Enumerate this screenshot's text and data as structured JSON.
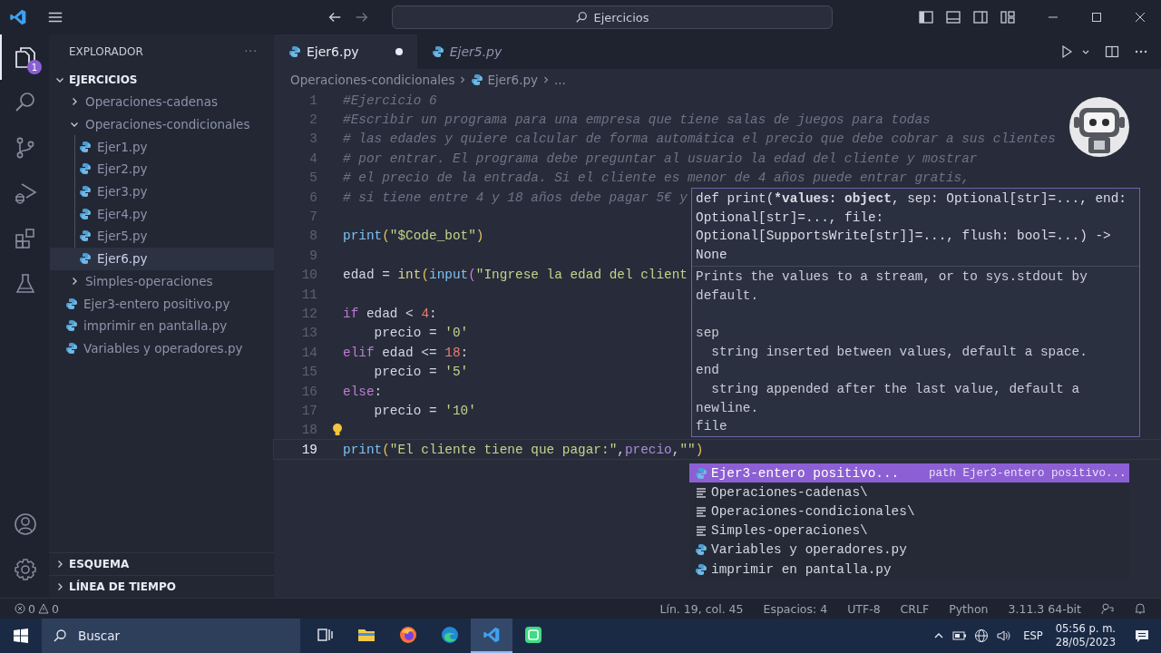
{
  "title_bar": {
    "search": "Ejercicios"
  },
  "activity_bar": {
    "top": [
      {
        "kind": "files",
        "selected": true,
        "badge": "1"
      },
      {
        "kind": "search",
        "selected": false
      },
      {
        "kind": "branch",
        "selected": false
      },
      {
        "kind": "run",
        "selected": false
      },
      {
        "kind": "extensions",
        "selected": false
      },
      {
        "kind": "flask",
        "selected": false
      }
    ],
    "bottom": [
      {
        "kind": "account",
        "selected": false
      },
      {
        "kind": "settings",
        "selected": false
      }
    ]
  },
  "sidebar": {
    "title": "EXPLORADOR",
    "more": "···",
    "root": {
      "label": "EJERCICIOS",
      "expanded": true,
      "children": [
        {
          "label": "Operaciones-cadenas",
          "kind": "folder",
          "expanded": false
        },
        {
          "label": "Operaciones-condicionales",
          "kind": "folder",
          "expanded": true,
          "children": [
            {
              "label": "Ejer1.py",
              "kind": "file",
              "selected": false
            },
            {
              "label": "Ejer2.py",
              "kind": "file",
              "selected": false
            },
            {
              "label": "Ejer3.py",
              "kind": "file",
              "selected": false
            },
            {
              "label": "Ejer4.py",
              "kind": "file",
              "selected": false
            },
            {
              "label": "Ejer5.py",
              "kind": "file",
              "selected": false
            },
            {
              "label": "Ejer6.py",
              "kind": "file",
              "selected": true
            }
          ]
        },
        {
          "label": "Simples-operaciones",
          "kind": "folder",
          "expanded": false
        },
        {
          "label": "Ejer3-entero positivo.py",
          "kind": "file",
          "selected": false
        },
        {
          "label": "imprimir en pantalla.py",
          "kind": "file",
          "selected": false
        },
        {
          "label": "Variables y operadores.py",
          "kind": "file",
          "selected": false
        }
      ]
    },
    "sections": [
      {
        "label": "ESQUEMA",
        "expanded": false
      },
      {
        "label": "LÍNEA DE TIEMPO",
        "expanded": false
      }
    ]
  },
  "tabs": [
    {
      "label": "Ejer6.py",
      "selected": true,
      "modified": true,
      "preview": false
    },
    {
      "label": "Ejer5.py",
      "selected": false,
      "modified": false,
      "preview": true
    }
  ],
  "breadcrumbs": [
    {
      "label": "Operaciones-condicionales",
      "kind": "folder"
    },
    {
      "label": "Ejer6.py",
      "kind": "file"
    },
    {
      "label": "...",
      "kind": "more"
    }
  ],
  "code": [
    {
      "n": "1",
      "tokens": [
        {
          "kind": "comment",
          "text": "#Ejercicio 6"
        }
      ]
    },
    {
      "n": "2",
      "tokens": [
        {
          "kind": "comment",
          "text": "#Escribir un programa para una empresa que tiene salas de juegos para todas"
        }
      ]
    },
    {
      "n": "3",
      "tokens": [
        {
          "kind": "comment",
          "text": "# las edades y quiere calcular de forma automática el precio que debe cobrar a sus clientes"
        }
      ]
    },
    {
      "n": "4",
      "tokens": [
        {
          "kind": "comment",
          "text": "# por entrar. El programa debe preguntar al usuario la edad del cliente y mostrar"
        }
      ]
    },
    {
      "n": "5",
      "tokens": [
        {
          "kind": "comment",
          "text": "# el precio de la entrada. Si el cliente es menor de 4 años puede entrar gratis,"
        }
      ]
    },
    {
      "n": "6",
      "tokens": [
        {
          "kind": "comment",
          "text": "# si tiene entre 4 y 18 años debe pagar 5€ y"
        }
      ]
    },
    {
      "n": "7"
    },
    {
      "n": "8",
      "tokens": [
        {
          "kind": "func",
          "text": "print"
        },
        {
          "kind": "paren",
          "text": "("
        },
        {
          "kind": "string",
          "text": "\"$Code_bot\""
        },
        {
          "kind": "paren",
          "text": ")"
        }
      ]
    },
    {
      "n": "9"
    },
    {
      "n": "10",
      "tokens": [
        {
          "kind": "plain",
          "text": "edad = "
        },
        {
          "kind": "class",
          "text": "int"
        },
        {
          "kind": "paren",
          "text": "("
        },
        {
          "kind": "func",
          "text": "input"
        },
        {
          "kind": "paren2",
          "text": "("
        },
        {
          "kind": "string",
          "text": "\"Ingrese la edad del client"
        }
      ]
    },
    {
      "n": "11"
    },
    {
      "n": "12",
      "tokens": [
        {
          "kind": "keyword",
          "text": "if"
        },
        {
          "kind": "plain",
          "text": " edad < "
        },
        {
          "kind": "number",
          "text": "4"
        },
        {
          "kind": "plain",
          "text": ":"
        }
      ]
    },
    {
      "n": "13",
      "tokens": [
        {
          "kind": "plain",
          "text": "    precio = "
        },
        {
          "kind": "string",
          "text": "'0'"
        }
      ]
    },
    {
      "n": "14",
      "tokens": [
        {
          "kind": "keyword",
          "text": "elif"
        },
        {
          "kind": "plain",
          "text": " edad <= "
        },
        {
          "kind": "number",
          "text": "18"
        },
        {
          "kind": "plain",
          "text": ":"
        }
      ]
    },
    {
      "n": "15",
      "tokens": [
        {
          "kind": "plain",
          "text": "    precio = "
        },
        {
          "kind": "string",
          "text": "'5'"
        }
      ]
    },
    {
      "n": "16",
      "tokens": [
        {
          "kind": "keyword",
          "text": "else"
        },
        {
          "kind": "plain",
          "text": ":"
        }
      ]
    },
    {
      "n": "17",
      "tokens": [
        {
          "kind": "plain",
          "text": "    precio = "
        },
        {
          "kind": "string",
          "text": "'10'"
        }
      ]
    },
    {
      "n": "18",
      "lightbulb": true
    },
    {
      "n": "19",
      "current": true,
      "tokens": [
        {
          "kind": "func",
          "text": "print"
        },
        {
          "kind": "paren",
          "text": "("
        },
        {
          "kind": "string",
          "text": "\"El cliente tiene que pagar:\""
        },
        {
          "kind": "plain",
          "text": ","
        },
        {
          "kind": "param",
          "text": "precio"
        },
        {
          "kind": "plain",
          "text": ","
        },
        {
          "kind": "string",
          "text": "\"\""
        },
        {
          "kind": "paren",
          "text": ")"
        }
      ]
    }
  ],
  "hover": {
    "signature": [
      [
        {
          "t": "def print(",
          "bold": false
        },
        {
          "t": "*values: object",
          "bold": true
        },
        {
          "t": ", sep: Optional[str]=..., end:",
          "bold": false
        }
      ],
      [
        {
          "t": "Optional[str]=..., file:",
          "bold": false
        }
      ],
      [
        {
          "t": "Optional[SupportsWrite[str]]=..., flush: bool=...) ->",
          "bold": false
        }
      ],
      [
        {
          "t": "None",
          "bold": false
        }
      ]
    ],
    "doc": [
      [
        "Prints the values to a stream, or to sys.stdout by",
        "default."
      ],
      [
        "sep",
        "  string inserted between values, default a space.",
        "end",
        "  string appended after the last value, default a",
        "newline.",
        "file"
      ]
    ]
  },
  "suggestions": [
    {
      "label": "Ejer3-entero positivo...",
      "kind": "file",
      "selected": true,
      "detail": "path Ejer3-entero positivo..."
    },
    {
      "label": "Operaciones-cadenas\\",
      "kind": "folder",
      "selected": false
    },
    {
      "label": "Operaciones-condicionales\\",
      "kind": "folder",
      "selected": false
    },
    {
      "label": "Simples-operaciones\\",
      "kind": "folder",
      "selected": false
    },
    {
      "label": "Variables y operadores.py",
      "kind": "file",
      "selected": false
    },
    {
      "label": "imprimir en pantalla.py",
      "kind": "file",
      "selected": false
    }
  ],
  "status_bar": {
    "errors": "0",
    "warnings": "0",
    "items": [
      "Lín. 19, col. 45",
      "Espacios: 4",
      "UTF-8",
      "CRLF",
      "Python",
      "3.11.3 64-bit"
    ]
  },
  "taskbar": {
    "search": "Buscar",
    "apps": [
      {
        "kind": "taskview",
        "selected": false
      },
      {
        "kind": "folder",
        "selected": false
      },
      {
        "kind": "firefox",
        "selected": false
      },
      {
        "kind": "edge",
        "selected": false
      },
      {
        "kind": "vscode",
        "selected": true
      },
      {
        "kind": "green",
        "selected": false
      }
    ],
    "language": "ESP",
    "time": "05:56 p. m.",
    "date": "28/05/2023"
  }
}
